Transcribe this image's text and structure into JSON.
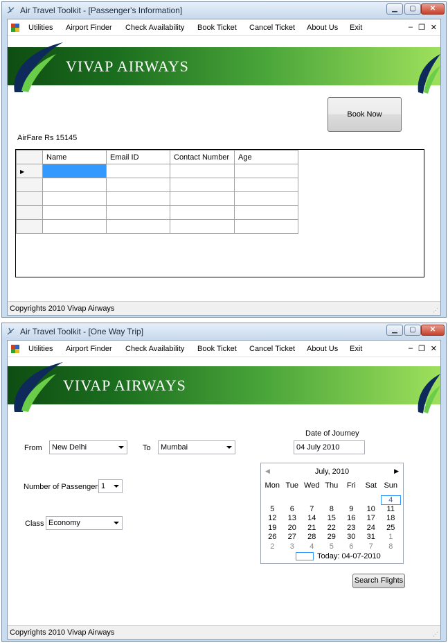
{
  "colors": {
    "title_bar": "#c7d9ec",
    "banner_green": "#2f8a2a",
    "selection_blue": "#3399ff"
  },
  "window1": {
    "title": "Air Travel Toolkit - [Passenger's Information]",
    "menu": [
      "Utilities",
      "Airport Finder",
      "Check Availability",
      "Book Ticket",
      "Cancel Ticket",
      "About Us",
      "Exit"
    ],
    "mdi": {
      "min": "–",
      "restore": "❐",
      "close": "✕"
    },
    "banner_title": "VIVAP AIRWAYS",
    "book_now": "Book Now",
    "airfare": "AirFare Rs 15145",
    "grid": {
      "columns": [
        "Name",
        "Email ID",
        "Contact Number",
        "Age"
      ],
      "rows": [
        [
          "",
          "",
          "",
          ""
        ],
        [
          "",
          "",
          "",
          ""
        ],
        [
          "",
          "",
          "",
          ""
        ],
        [
          "",
          "",
          "",
          ""
        ],
        [
          "",
          "",
          "",
          ""
        ]
      ],
      "row_marker": "▶"
    },
    "status": "Copyrights 2010 Vivap Airways"
  },
  "window2": {
    "title": "Air Travel Toolkit - [One Way Trip]",
    "menu": [
      "Utilities",
      "Airport Finder",
      "Check Availability",
      "Book Ticket",
      "Cancel Ticket",
      "About Us",
      "Exit"
    ],
    "mdi": {
      "min": "–",
      "restore": "❐",
      "close": "✕"
    },
    "banner_title": "VIVAP AIRWAYS",
    "from_label": "From",
    "from_value": "New Delhi",
    "to_label": "To",
    "to_value": "Mumbai",
    "passengers_label": "Number of Passengers",
    "passengers_value": "1",
    "class_label": "Class",
    "class_value": "Economy",
    "journey_label": "Date of Journey",
    "journey_value": "04 July 2010",
    "calendar": {
      "month": "July, 2010",
      "prev": "◀",
      "next": "▶",
      "days": [
        "Mon",
        "Tue",
        "Wed",
        "Thu",
        "Fri",
        "Sat",
        "Sun"
      ],
      "cells": [
        {
          "d": "",
          "c": "blank"
        },
        {
          "d": "",
          "c": "blank"
        },
        {
          "d": "",
          "c": "blank"
        },
        {
          "d": "",
          "c": "blank"
        },
        {
          "d": "",
          "c": "blank"
        },
        {
          "d": "",
          "c": "blank"
        },
        {
          "d": "4",
          "c": "today"
        },
        {
          "d": "5",
          "c": ""
        },
        {
          "d": "6",
          "c": ""
        },
        {
          "d": "7",
          "c": ""
        },
        {
          "d": "8",
          "c": ""
        },
        {
          "d": "9",
          "c": ""
        },
        {
          "d": "10",
          "c": ""
        },
        {
          "d": "11",
          "c": ""
        },
        {
          "d": "12",
          "c": ""
        },
        {
          "d": "13",
          "c": ""
        },
        {
          "d": "14",
          "c": ""
        },
        {
          "d": "15",
          "c": ""
        },
        {
          "d": "16",
          "c": ""
        },
        {
          "d": "17",
          "c": ""
        },
        {
          "d": "18",
          "c": ""
        },
        {
          "d": "19",
          "c": ""
        },
        {
          "d": "20",
          "c": ""
        },
        {
          "d": "21",
          "c": ""
        },
        {
          "d": "22",
          "c": ""
        },
        {
          "d": "23",
          "c": ""
        },
        {
          "d": "24",
          "c": ""
        },
        {
          "d": "25",
          "c": ""
        },
        {
          "d": "26",
          "c": ""
        },
        {
          "d": "27",
          "c": ""
        },
        {
          "d": "28",
          "c": ""
        },
        {
          "d": "29",
          "c": ""
        },
        {
          "d": "30",
          "c": ""
        },
        {
          "d": "31",
          "c": ""
        },
        {
          "d": "1",
          "c": "dim"
        },
        {
          "d": "2",
          "c": "dim"
        },
        {
          "d": "3",
          "c": "dim"
        },
        {
          "d": "4",
          "c": "dim"
        },
        {
          "d": "5",
          "c": "dim"
        },
        {
          "d": "6",
          "c": "dim"
        },
        {
          "d": "7",
          "c": "dim"
        },
        {
          "d": "8",
          "c": "dim"
        }
      ],
      "today_text": "Today: 04-07-2010"
    },
    "search_flights": "Search Flights",
    "status": "Copyrights 2010 Vivap Airways"
  }
}
